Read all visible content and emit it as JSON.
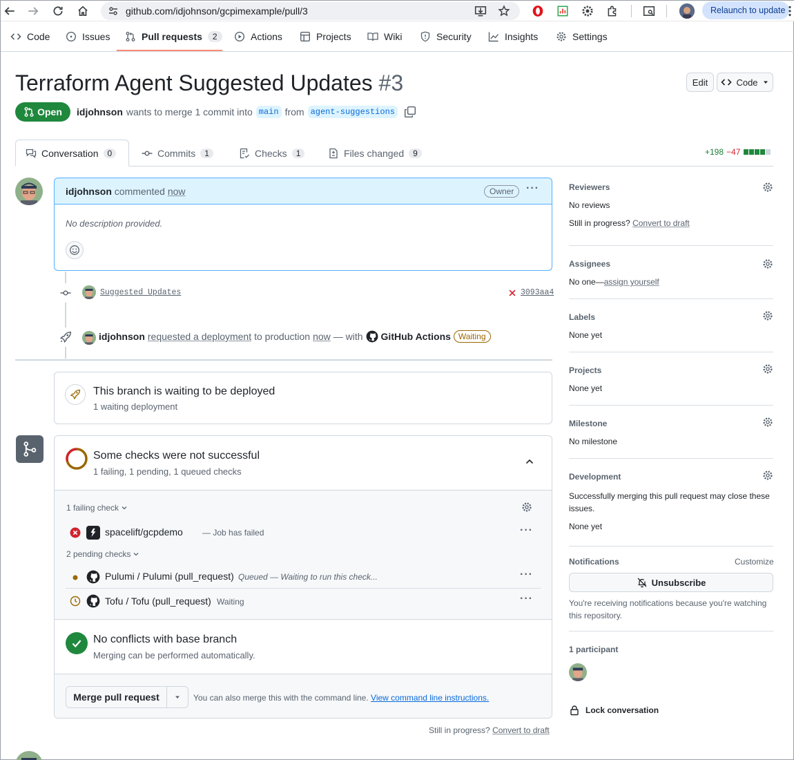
{
  "browser": {
    "url": "github.com/idjohnson/gcpimexample/pull/3",
    "relaunch_label": "Relaunch to update"
  },
  "repo_nav": {
    "items": [
      {
        "label": "Code",
        "icon": "code-icon"
      },
      {
        "label": "Issues",
        "icon": "issue-icon"
      },
      {
        "label": "Pull requests",
        "icon": "pull-request-icon",
        "count": "2",
        "selected": true
      },
      {
        "label": "Actions",
        "icon": "play-icon"
      },
      {
        "label": "Projects",
        "icon": "table-icon"
      },
      {
        "label": "Wiki",
        "icon": "book-icon"
      },
      {
        "label": "Security",
        "icon": "shield-icon"
      },
      {
        "label": "Insights",
        "icon": "graph-icon"
      },
      {
        "label": "Settings",
        "icon": "gear-icon"
      }
    ]
  },
  "pr": {
    "title": "Terraform Agent Suggested Updates",
    "number": "#3",
    "edit_label": "Edit",
    "code_label": "Code",
    "state": "Open",
    "author": "idjohnson",
    "merge_text": "wants to merge 1 commit into",
    "base_branch": "main",
    "from_text": "from",
    "head_branch": "agent-suggestions"
  },
  "tabs": [
    {
      "label": "Conversation",
      "count": "0",
      "icon": "comment-discussion-icon"
    },
    {
      "label": "Commits",
      "count": "1",
      "icon": "commit-icon"
    },
    {
      "label": "Checks",
      "count": "1",
      "icon": "checklist-icon"
    },
    {
      "label": "Files changed",
      "count": "9",
      "icon": "file-diff-icon"
    }
  ],
  "diffstat": {
    "additions": "+198",
    "deletions": "−47"
  },
  "comment": {
    "author": "idjohnson",
    "action": "commented",
    "time": "now",
    "role": "Owner",
    "body": "No description provided."
  },
  "timeline": {
    "commit_message": "Suggested Updates",
    "commit_sha": "3093aa4",
    "deploy_actor": "idjohnson",
    "deploy_action": "requested a deployment",
    "deploy_to": "to production",
    "deploy_time": "now",
    "deploy_with": "— with",
    "deploy_app": "GitHub Actions",
    "deploy_state": "Waiting"
  },
  "deployment": {
    "title": "This branch is waiting to be deployed",
    "subtitle": "1 waiting deployment"
  },
  "checks": {
    "title": "Some checks were not successful",
    "subtitle": "1 failing, 1 pending, 1 queued checks",
    "failing_header": "1 failing check",
    "failing": [
      {
        "name": "spacelift/gcpdemo",
        "status": "— Job has failed"
      }
    ],
    "pending_header": "2 pending checks",
    "pending": [
      {
        "name": "Pulumi / Pulumi (pull_request)",
        "status": "Queued — Waiting to run this check..."
      },
      {
        "name": "Tofu / Tofu (pull_request)",
        "status": "Waiting"
      }
    ]
  },
  "conflicts": {
    "title": "No conflicts with base branch",
    "subtitle": "Merging can be performed automatically."
  },
  "merge": {
    "button_label": "Merge pull request",
    "hint": "You can also merge this with the command line.",
    "hint_link": "View command line instructions."
  },
  "footer": {
    "still_text": "Still in progress?",
    "draft_link": "Convert to draft"
  },
  "sidebar": {
    "reviewers": {
      "title": "Reviewers",
      "value": "No reviews",
      "still": "Still in progress?",
      "draft_link": "Convert to draft"
    },
    "assignees": {
      "title": "Assignees",
      "value": "No one—",
      "assign_link": "assign yourself"
    },
    "labels": {
      "title": "Labels",
      "value": "None yet"
    },
    "projects": {
      "title": "Projects",
      "value": "None yet"
    },
    "milestone": {
      "title": "Milestone",
      "value": "No milestone"
    },
    "development": {
      "title": "Development",
      "text": "Successfully merging this pull request may close these issues.",
      "value": "None yet"
    },
    "notifications": {
      "title": "Notifications",
      "customize": "Customize",
      "unsubscribe": "Unsubscribe",
      "reason": "You're receiving notifications because you're watching this repository."
    },
    "participants": {
      "title": "1 participant"
    },
    "lock": "Lock conversation"
  }
}
